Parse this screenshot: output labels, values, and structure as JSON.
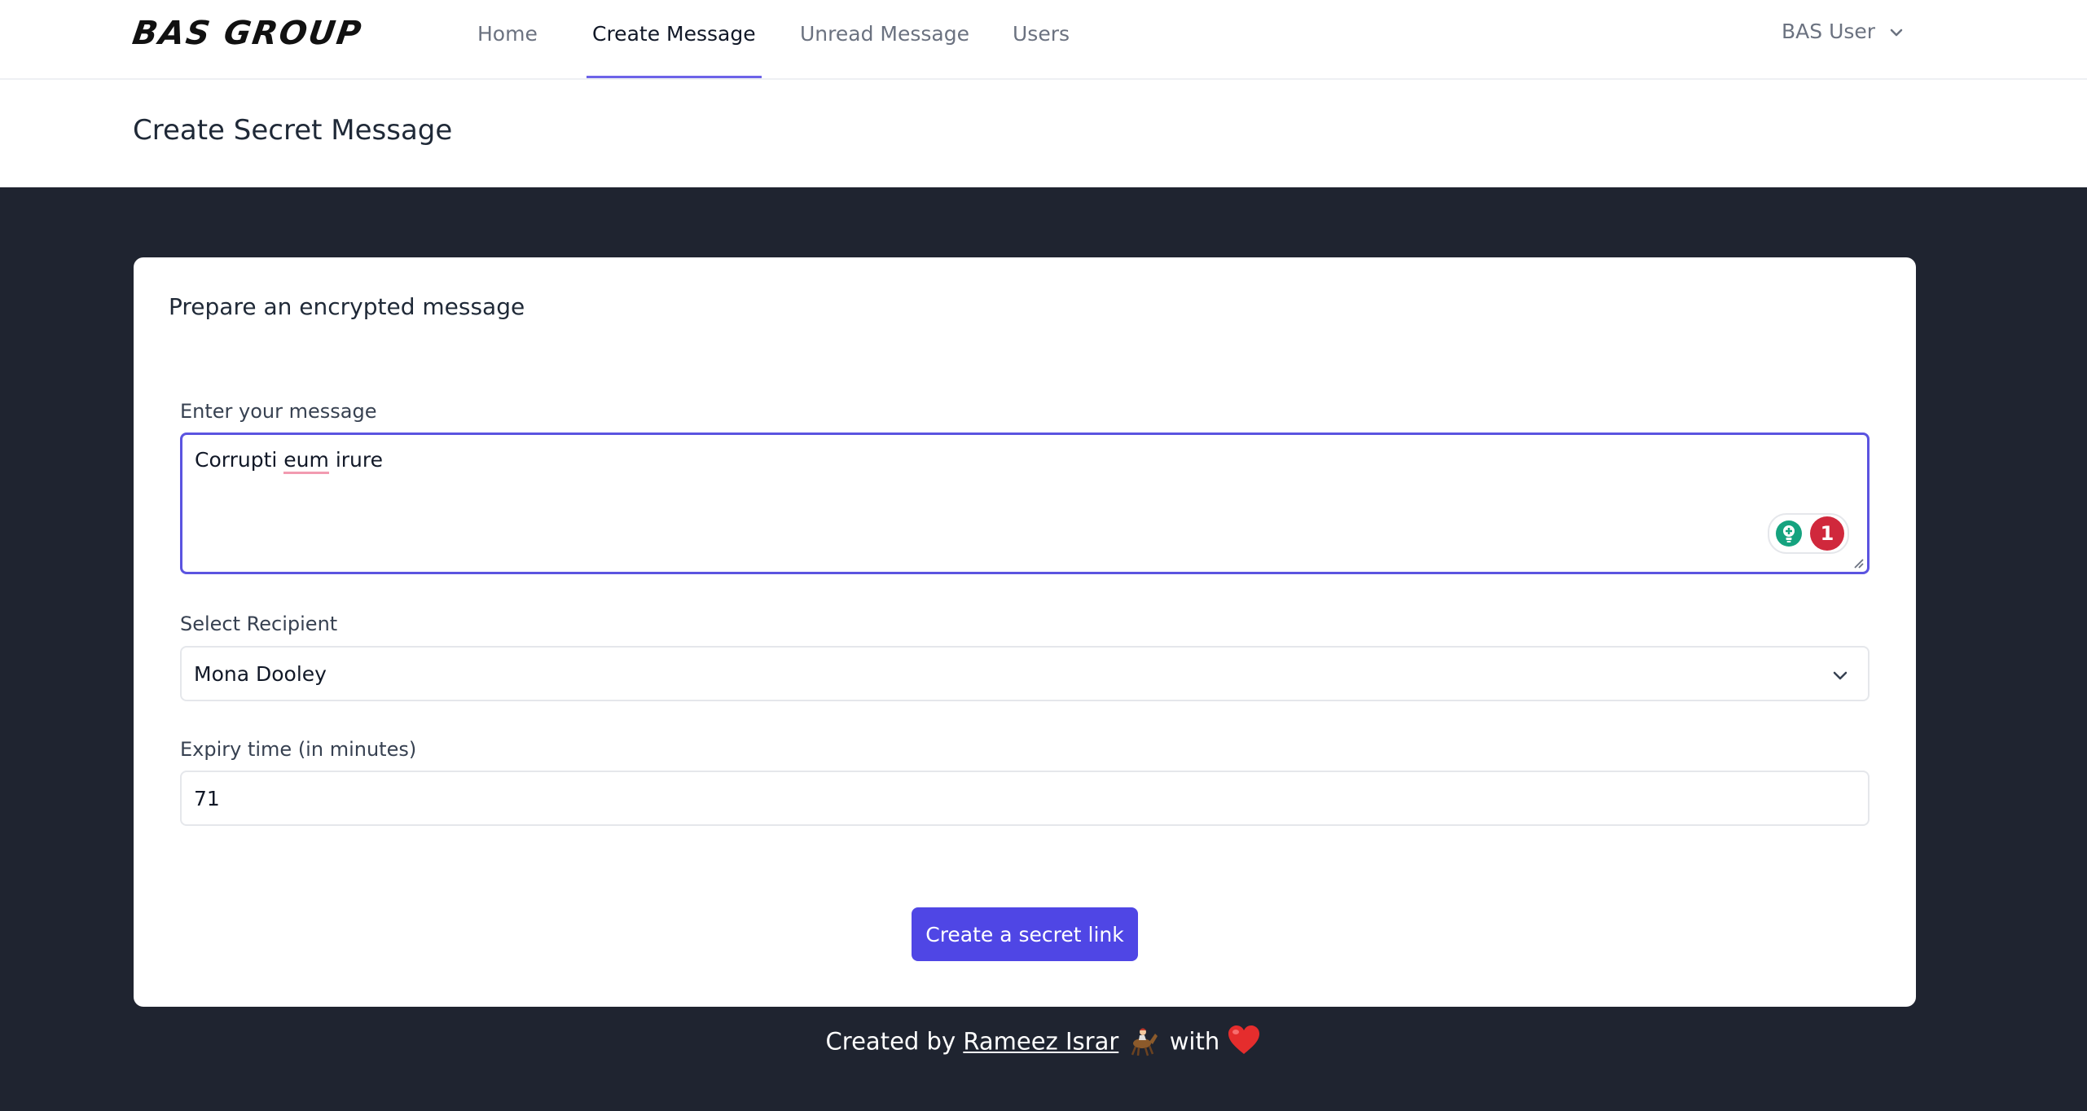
{
  "nav": {
    "logo": "BAS GROUP",
    "links": [
      "Home",
      "Create Message",
      "Unread Message",
      "Users"
    ],
    "active": "Create Message",
    "user": "BAS User"
  },
  "header": {
    "title": "Create Secret Message"
  },
  "form": {
    "heading": "Prepare an encrypted message",
    "message_label": "Enter your message",
    "message_value_before": "Corrupti ",
    "message_value_flagged": "eum",
    "message_value_after": " irure",
    "grammar_issue_count": "1",
    "recipient_label": "Select Recipient",
    "recipient_value": "Mona Dooley",
    "expiry_label": "Expiry time (in minutes)",
    "expiry_value": "71",
    "submit_label": "Create a secret link"
  },
  "footer": {
    "prefix": "Created by",
    "author": "Rameez Israr",
    "with": "with"
  },
  "colors": {
    "accent": "#4f46e5",
    "footer_bg": "#1f2430"
  }
}
